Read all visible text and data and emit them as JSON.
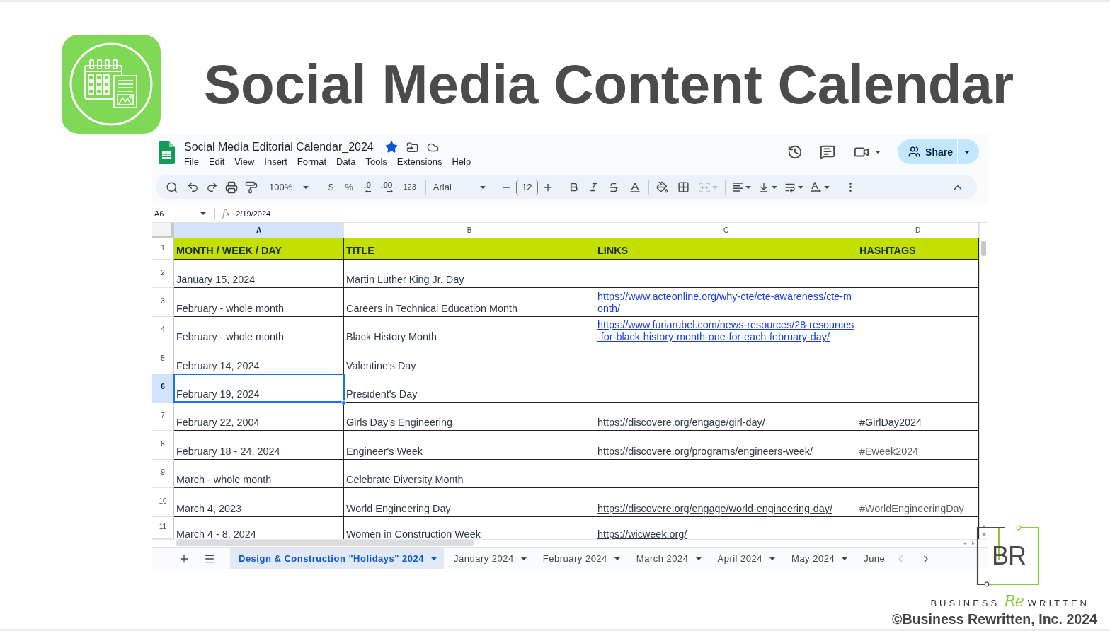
{
  "header": {
    "title": "Social Media Content Calendar"
  },
  "sheet": {
    "doc_title": "Social Media Editorial Calendar_2024",
    "starred": true,
    "menu": [
      "File",
      "Edit",
      "View",
      "Insert",
      "Format",
      "Data",
      "Tools",
      "Extensions",
      "Help"
    ],
    "share_label": "Share",
    "toolbar": {
      "zoom": "100%",
      "currency": "$",
      "percent": "%",
      "decrease_decimal": ".0",
      "increase_decimal": ".00",
      "number_format": "123",
      "font": "Arial",
      "font_size": "12",
      "merge_disabled": true
    },
    "formula_bar": {
      "cell_ref": "A6",
      "fx": "fx",
      "value": "2/19/2024"
    },
    "columns": [
      {
        "label": "A",
        "selected": true
      },
      {
        "label": "B",
        "selected": false
      },
      {
        "label": "C",
        "selected": false
      },
      {
        "label": "D",
        "selected": false
      }
    ],
    "rows": [
      {
        "number": "1",
        "selected": false,
        "kind": "header",
        "a": "MONTH / WEEK / DAY",
        "b": "TITLE",
        "c": {
          "text": "LINKS"
        },
        "d": {
          "text": "HASHTAGS"
        }
      },
      {
        "number": "2",
        "selected": false,
        "kind": "data",
        "a": "January 15, 2024",
        "b": "Martin Luther King Jr. Day"
      },
      {
        "number": "3",
        "selected": false,
        "kind": "data",
        "a": "February - whole month",
        "b": "Careers in Technical Education Month",
        "c": {
          "text": "https://www.acteonline.org/why-cte/cte-awareness/cte-month/",
          "color": "#1a3de0"
        }
      },
      {
        "number": "4",
        "selected": false,
        "kind": "data",
        "a": "February - whole month",
        "b": "Black History Month",
        "c": {
          "text": "https://www.furiarubel.com/news-resources/28-resources-for-black-history-month-one-for-each-february-day/",
          "color": "#1a3de0"
        }
      },
      {
        "number": "5",
        "selected": false,
        "kind": "data",
        "a": "February 14, 2024",
        "b": "Valentine's Day"
      },
      {
        "number": "6",
        "selected": true,
        "kind": "data",
        "a": "February 19, 2024",
        "b": "President's Day"
      },
      {
        "number": "7",
        "selected": false,
        "kind": "data",
        "a": "February 22, 2004",
        "b": "Girls Day's Engineering",
        "c": {
          "text": "https://discovere.org/engage/girl-day/",
          "color": "#2e3a48"
        },
        "d": {
          "text": "#GirlDay2024",
          "color": "#2e3a48"
        }
      },
      {
        "number": "8",
        "selected": false,
        "kind": "data",
        "a": "February 18 - 24, 2024",
        "b": "Engineer's Week",
        "c": {
          "text": "https://discovere.org/programs/engineers-week/",
          "color": "#2e3a48"
        },
        "d": {
          "text": "#Eweek2024",
          "color": "#5f5f66"
        }
      },
      {
        "number": "9",
        "selected": false,
        "kind": "data",
        "a": "March - whole month",
        "b": "Celebrate Diversity Month"
      },
      {
        "number": "10",
        "selected": false,
        "kind": "data",
        "a": "March 4, 2023",
        "b": "World Engineering Day",
        "c": {
          "text": "https://discovere.org/engage/world-engineering-day/",
          "color": "#2e3a48"
        },
        "d": {
          "text": "#WorldEngineeringDay",
          "color": "#5f5f66"
        }
      },
      {
        "number": "11",
        "selected": false,
        "kind": "data",
        "a": "March 4 - 8, 2024",
        "b": "Women in Construction Week",
        "c": {
          "text": "https://wicweek.org/",
          "color": "#2e3a48"
        }
      }
    ],
    "tabs": [
      {
        "label": "Design & Construction \"Holidays\" 2024",
        "selected": true,
        "menu": true
      },
      {
        "label": "January 2024",
        "selected": false,
        "menu": true
      },
      {
        "label": "February 2024",
        "selected": false,
        "menu": true
      },
      {
        "label": "March 2024",
        "selected": false,
        "menu": true
      },
      {
        "label": "April 2024",
        "selected": false,
        "menu": true
      },
      {
        "label": "May 2024",
        "selected": false,
        "menu": true
      },
      {
        "label": "June",
        "selected": false,
        "menu": false
      }
    ],
    "tab_nav": {
      "previous_disabled": true,
      "next_disabled": false
    }
  },
  "footer": {
    "monogram": "BR",
    "wordmark_start": "BUSINESS",
    "wordmark_script": "Re",
    "wordmark_end": "WRITTEN",
    "copyright": "©Business Rewritten, Inc. 2024"
  }
}
